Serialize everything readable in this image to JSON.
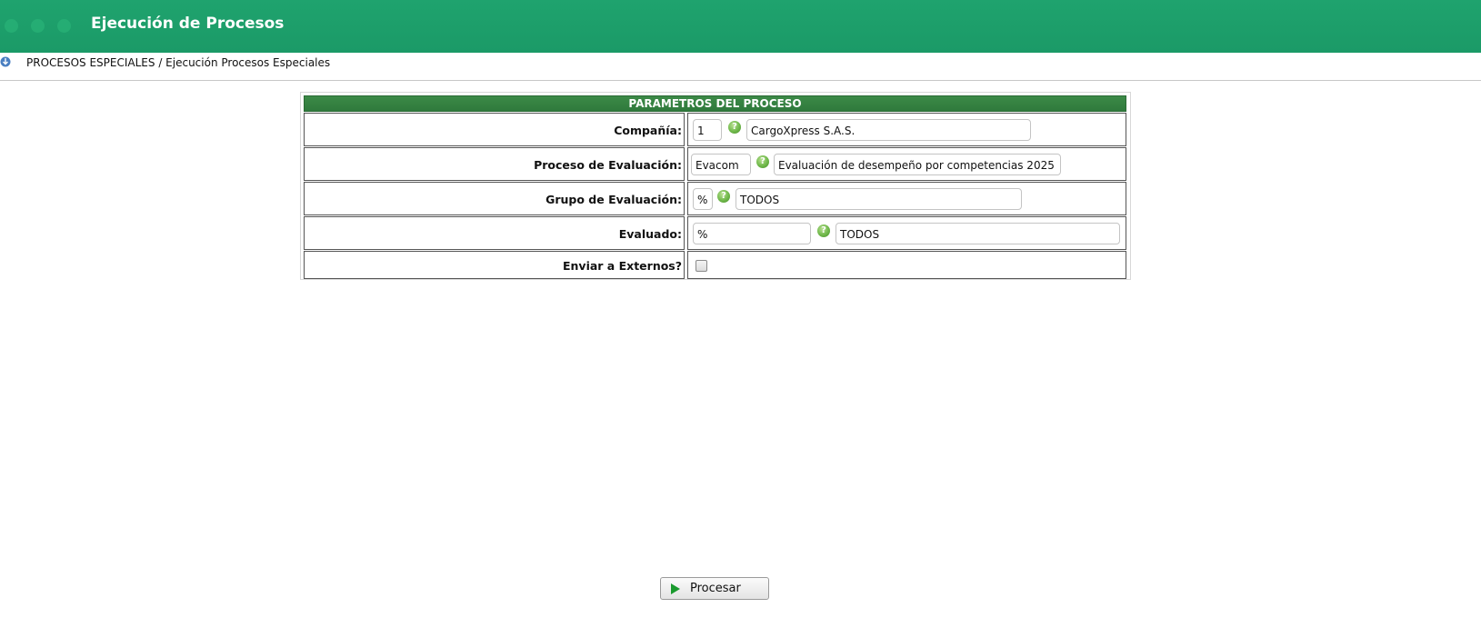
{
  "header": {
    "title": "Ejecución de Procesos"
  },
  "breadcrumb": {
    "text": "PROCESOS ESPECIALES / Ejecución Procesos Especiales",
    "icon": "info-download-icon"
  },
  "form": {
    "heading": "PARAMETROS DEL PROCESO",
    "compania": {
      "label": "Compañía:",
      "code": "1",
      "description": "CargoXpress S.A.S."
    },
    "proceso": {
      "label": "Proceso de Evaluación:",
      "code": "Evacom",
      "description": "Evaluación de desempeño por competencias 2025"
    },
    "grupo": {
      "label": "Grupo de Evaluación:",
      "code": "%",
      "description": "TODOS"
    },
    "evaluado": {
      "label": "Evaluado:",
      "code": "%",
      "description": "TODOS"
    },
    "externos": {
      "label": "Enviar a Externos?",
      "checked": false
    }
  },
  "actions": {
    "process_label": "Procesar"
  },
  "colors": {
    "header_bg": "#1b9a67",
    "panel_head_bg": "#2f7a3c",
    "help_icon": "#6fb84a"
  }
}
